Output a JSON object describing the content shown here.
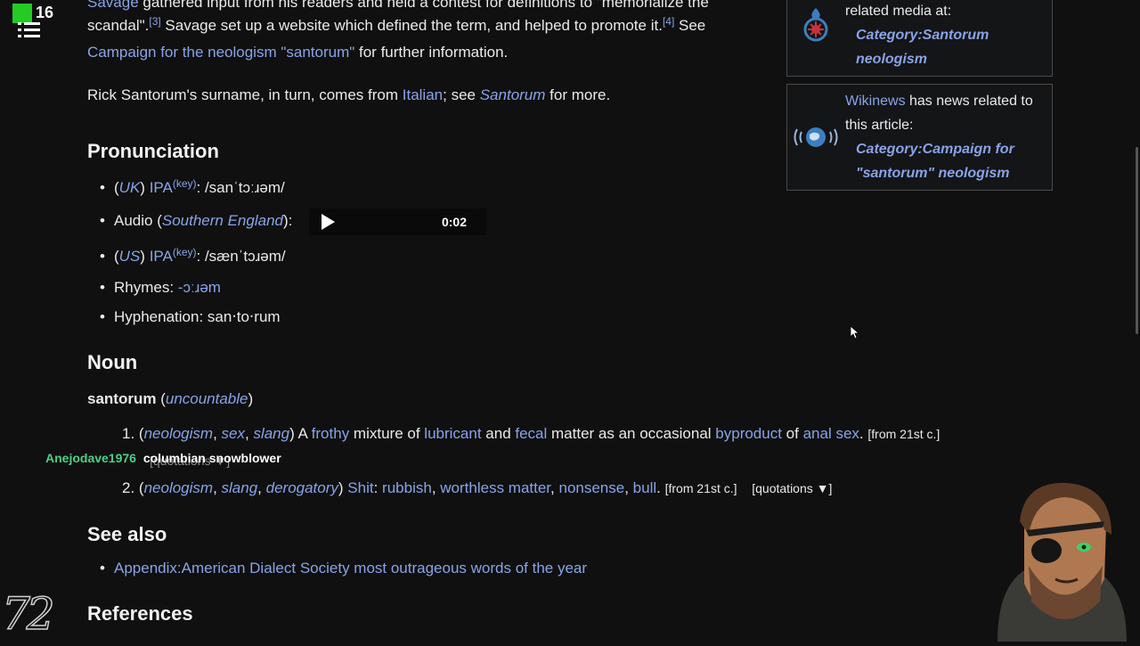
{
  "overlay": {
    "counter": "16",
    "chat_user": "Anejodave1976",
    "chat_message": "columbian snowblower",
    "logo": "72"
  },
  "article": {
    "etym": {
      "l1a": "Savage",
      "l1b": " gathered input from his readers and held a contest for definitions to \"memorialize the",
      "l2a": "scandal\".",
      "ref3": "[3]",
      "l2b": " Savage set up a website which defined the term, and helped to promote it.",
      "ref4": "[4]",
      "l2c": " See",
      "l3a": "Campaign for the neologism \"santorum\"",
      "l3b": " for further information.",
      "p2a": "Rick Santorum's surname, in turn, comes from ",
      "p2b": "Italian",
      "p2c": "; see ",
      "p2d": "Santorum",
      "p2e": " for more."
    },
    "pronunciation": {
      "heading": "Pronunciation",
      "uk": {
        "open": "(",
        "region": "UK",
        "close": ")",
        "ipa": "IPA",
        "key": "(key)",
        "value": ": /sanˈtɔːɹəm/"
      },
      "audio": {
        "label": "Audio (",
        "region": "Southern England",
        "close": "):",
        "time": "0:02"
      },
      "us": {
        "open": "(",
        "region": "US",
        "close": ")",
        "ipa": "IPA",
        "key": "(key)",
        "value": ": /sænˈtɔɹəm/"
      },
      "rhymes": {
        "label": "Rhymes: ",
        "value": "-ɔːɹəm"
      },
      "hyphenation": "Hyphenation: san‧to‧rum"
    },
    "noun": {
      "heading": "Noun",
      "headword": "santorum",
      "open": " (",
      "uncountable": "uncountable",
      "close": ")",
      "def1": {
        "num": "1.",
        "tags": [
          "neologism",
          "sex",
          "slang"
        ],
        "parts": [
          "A ",
          "frothy",
          " mixture of ",
          "lubricant",
          " and ",
          "fecal",
          " matter as an occasional ",
          "byproduct",
          " of ",
          "anal sex",
          "."
        ],
        "date": "[from 21st c.]",
        "quotations": "[quotations ▼]"
      },
      "def2": {
        "num": "2.",
        "tags": [
          "neologism",
          "slang",
          "derogatory"
        ],
        "shit": "Shit",
        "links": [
          "rubbish",
          "worthless matter",
          "nonsense",
          "bull"
        ],
        "date": "[from 21st c.]",
        "quotations": "[quotations ▼]"
      }
    },
    "see_also": {
      "heading": "See also",
      "item": "Appendix:American Dialect Society most outrageous words of the year"
    },
    "references": {
      "heading": "References"
    }
  },
  "sidebar": {
    "commons": {
      "text": "related media at:",
      "link1": "Category:Santorum",
      "link2": "neologism"
    },
    "wikinews": {
      "site": "Wikinews",
      "text1": " has news related to",
      "text2": "this article:",
      "link1": "Category:Campaign for",
      "link2": "\"santorum\" neologism"
    }
  },
  "colors": {
    "link": "#88a3e8",
    "background": "#101010",
    "chat_user": "#4ad08a"
  }
}
